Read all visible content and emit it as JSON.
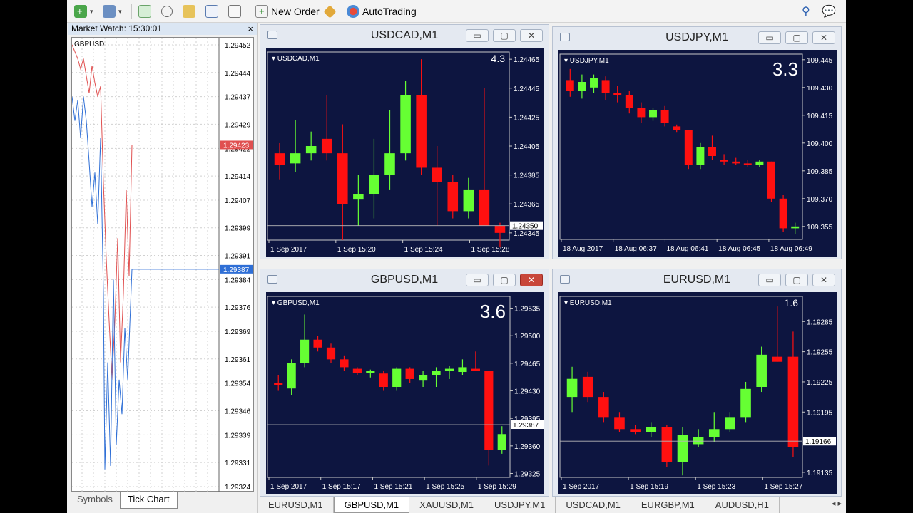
{
  "toolbar": {
    "new_order": "New Order",
    "auto_trading": "AutoTrading"
  },
  "market_watch": {
    "title": "Market Watch: 15:30:01",
    "close": "×",
    "chart_label": "GBPUSD",
    "price_levels": [
      "1.29452",
      "1.29444",
      "1.29437",
      "1.29429",
      "1.29422",
      "1.29414",
      "1.29407",
      "1.29399",
      "1.29391",
      "1.29384",
      "1.29376",
      "1.29369",
      "1.29361",
      "1.29354",
      "1.29346",
      "1.29339",
      "1.29331",
      "1.29324"
    ],
    "bid_marker": "1.29387",
    "ask_marker": "1.29423",
    "tabs": [
      "Symbols",
      "Tick Chart"
    ]
  },
  "windows": [
    {
      "title": "USDCAD,M1",
      "label": "USDCAD,M1",
      "big": "4.3",
      "price_axis": [
        "1.24465",
        "1.24445",
        "1.24425",
        "1.24405",
        "1.24385",
        "1.24365",
        "1.24345"
      ],
      "current_price": "1.24350",
      "time_axis": [
        "1 Sep 2017",
        "1 Sep 15:20",
        "1 Sep 15:24",
        "1 Sep 15:28"
      ]
    },
    {
      "title": "USDJPY,M1",
      "label": "USDJPY,M1",
      "big": "3.3",
      "price_axis": [
        "109.445",
        "109.430",
        "109.415",
        "109.400",
        "109.385",
        "109.370",
        "109.355"
      ],
      "current_price": "",
      "time_axis": [
        "18 Aug 2017",
        "18 Aug 06:37",
        "18 Aug 06:41",
        "18 Aug 06:45",
        "18 Aug 06:49"
      ]
    },
    {
      "title": "GBPUSD,M1",
      "label": "GBPUSD,M1",
      "big": "3.6",
      "price_axis": [
        "1.29535",
        "1.29500",
        "1.29465",
        "1.29430",
        "1.29395",
        "1.29360",
        "1.29325"
      ],
      "current_price": "1.29387",
      "time_axis": [
        "1 Sep 2017",
        "1 Sep 15:17",
        "1 Sep 15:21",
        "1 Sep 15:25",
        "1 Sep 15:29"
      ]
    },
    {
      "title": "EURUSD,M1",
      "label": "EURUSD,M1",
      "big": "1.6",
      "price_axis": [
        "1.19285",
        "1.19255",
        "1.19225",
        "1.19195",
        "1.19165",
        "1.19135"
      ],
      "current_price": "1.19166",
      "time_axis": [
        "1 Sep 2017",
        "1 Sep 15:19",
        "1 Sep 15:23",
        "1 Sep 15:27"
      ]
    }
  ],
  "bottom_tabs": [
    "EURUSD,M1",
    "GBPUSD,M1",
    "XAUUSD,M1",
    "USDJPY,M1",
    "USDCAD,M1",
    "EURGBP,M1",
    "AUDUSD,H1"
  ],
  "active_bottom_tab": "GBPUSD,M1",
  "chart_data": [
    {
      "type": "candlestick",
      "title": "USDCAD,M1",
      "ylim": [
        1.2434,
        1.2447
      ],
      "candles": [
        [
          1.244,
          1.24407,
          1.24382,
          1.24392
        ],
        [
          1.24393,
          1.24423,
          1.24387,
          1.244
        ],
        [
          1.244,
          1.24415,
          1.24395,
          1.24405
        ],
        [
          1.2441,
          1.2444,
          1.24395,
          1.244
        ],
        [
          1.244,
          1.2442,
          1.2434,
          1.24365
        ],
        [
          1.24368,
          1.24385,
          1.2435,
          1.24372
        ],
        [
          1.24372,
          1.2441,
          1.24355,
          1.24385
        ],
        [
          1.24385,
          1.2443,
          1.24375,
          1.244
        ],
        [
          1.244,
          1.2445,
          1.24395,
          1.2444
        ],
        [
          1.2444,
          1.24465,
          1.24385,
          1.2439
        ],
        [
          1.2439,
          1.24405,
          1.2435,
          1.2438
        ],
        [
          1.2438,
          1.24385,
          1.24355,
          1.2436
        ],
        [
          1.2436,
          1.24383,
          1.24355,
          1.24375
        ],
        [
          1.24375,
          1.24445,
          1.2435,
          1.2435
        ],
        [
          1.2435,
          1.24352,
          1.24335,
          1.24345
        ]
      ]
    },
    {
      "type": "candlestick",
      "title": "USDJPY,M1",
      "ylim": [
        109.348,
        109.448
      ],
      "candles": [
        [
          109.434,
          109.44,
          109.425,
          109.428
        ],
        [
          109.428,
          109.437,
          109.424,
          109.433
        ],
        [
          109.43,
          109.437,
          109.427,
          109.435
        ],
        [
          109.434,
          109.436,
          109.423,
          109.427
        ],
        [
          109.427,
          109.431,
          109.422,
          109.426
        ],
        [
          109.426,
          109.428,
          109.416,
          109.419
        ],
        [
          109.419,
          109.422,
          109.411,
          109.414
        ],
        [
          109.414,
          109.419,
          109.412,
          109.418
        ],
        [
          109.418,
          109.42,
          109.409,
          109.411
        ],
        [
          109.409,
          109.41,
          109.406,
          109.407
        ],
        [
          109.407,
          109.407,
          109.386,
          109.388
        ],
        [
          109.388,
          109.4,
          109.386,
          109.398
        ],
        [
          109.398,
          109.404,
          109.391,
          109.393
        ],
        [
          109.391,
          109.394,
          109.388,
          109.39
        ],
        [
          109.39,
          109.392,
          109.388,
          109.389
        ],
        [
          109.389,
          109.391,
          109.387,
          109.388
        ],
        [
          109.388,
          109.391,
          109.387,
          109.39
        ],
        [
          109.39,
          109.39,
          109.368,
          109.37
        ],
        [
          109.37,
          109.372,
          109.352,
          109.354
        ],
        [
          109.354,
          109.357,
          109.351,
          109.355
        ]
      ]
    },
    {
      "type": "candlestick",
      "title": "GBPUSD,M1",
      "ylim": [
        1.2932,
        1.2955
      ],
      "candles": [
        [
          1.2944,
          1.2945,
          1.2943,
          1.29437
        ],
        [
          1.29433,
          1.2947,
          1.29425,
          1.29465
        ],
        [
          1.29465,
          1.29527,
          1.2946,
          1.29495
        ],
        [
          1.29495,
          1.295,
          1.2948,
          1.29485
        ],
        [
          1.29485,
          1.2949,
          1.29465,
          1.2947
        ],
        [
          1.2947,
          1.29475,
          1.29455,
          1.2946
        ],
        [
          1.29458,
          1.2946,
          1.2945,
          1.29453
        ],
        [
          1.29453,
          1.29457,
          1.29447,
          1.29455
        ],
        [
          1.29452,
          1.29455,
          1.2943,
          1.29435
        ],
        [
          1.29435,
          1.2946,
          1.2943,
          1.29458
        ],
        [
          1.29458,
          1.2946,
          1.2944,
          1.29445
        ],
        [
          1.29443,
          1.29455,
          1.29435,
          1.2945
        ],
        [
          1.2945,
          1.2946,
          1.29435,
          1.29455
        ],
        [
          1.29455,
          1.29462,
          1.29445,
          1.29458
        ],
        [
          1.29454,
          1.2947,
          1.2945,
          1.2946
        ],
        [
          1.29458,
          1.2948,
          1.29455,
          1.29455
        ],
        [
          1.29455,
          1.29455,
          1.29335,
          1.29355
        ],
        [
          1.29355,
          1.29385,
          1.2935,
          1.29375
        ]
      ]
    },
    {
      "type": "candlestick",
      "title": "EURUSD,M1",
      "ylim": [
        1.1913,
        1.1931
      ],
      "candles": [
        [
          1.1921,
          1.1924,
          1.19195,
          1.19228
        ],
        [
          1.1923,
          1.19235,
          1.19205,
          1.1921
        ],
        [
          1.1921,
          1.19215,
          1.19185,
          1.1919
        ],
        [
          1.1919,
          1.19195,
          1.19175,
          1.19178
        ],
        [
          1.19178,
          1.19182,
          1.19173,
          1.19175
        ],
        [
          1.19175,
          1.19185,
          1.1917,
          1.1918
        ],
        [
          1.1918,
          1.19182,
          1.1914,
          1.19145
        ],
        [
          1.19145,
          1.1918,
          1.19132,
          1.19172
        ],
        [
          1.19163,
          1.19178,
          1.1916,
          1.1917
        ],
        [
          1.1917,
          1.19195,
          1.19165,
          1.19178
        ],
        [
          1.19178,
          1.19195,
          1.19175,
          1.1919
        ],
        [
          1.1919,
          1.19225,
          1.19185,
          1.19218
        ],
        [
          1.1922,
          1.1926,
          1.19215,
          1.19252
        ],
        [
          1.1925,
          1.193,
          1.19245,
          1.19245
        ],
        [
          1.1925,
          1.19275,
          1.1915,
          1.1916
        ]
      ]
    }
  ]
}
